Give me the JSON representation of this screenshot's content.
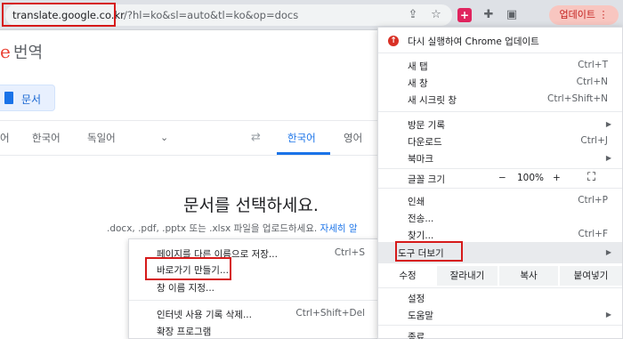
{
  "browser": {
    "url_host": "translate.google.co.kr",
    "url_path": "/?hl=ko&sl=auto&tl=ko&op=docs",
    "update_button": "업데이트 ⋮"
  },
  "page": {
    "logo_letter": "e",
    "logo_text": "번역",
    "docs_chip": "문서",
    "source_langs": [
      "어",
      "한국어",
      "독일어"
    ],
    "target_langs": [
      "한국어",
      "영어"
    ],
    "heading": "문서를 선택하세요.",
    "subtitle": ".docx, .pdf, .pptx 또는 .xlsx 파일을 업로드하세요.",
    "subtitle_link": "자세히 알"
  },
  "context_menu": {
    "items": [
      {
        "label": "페이지를 다른 이름으로 저장...",
        "shortcut": "Ctrl+S"
      },
      {
        "label": "바로가기 만들기...",
        "shortcut": ""
      },
      {
        "label": "창 이름 지정...",
        "shortcut": ""
      },
      {
        "label": "인터넷 사용 기록 삭제...",
        "shortcut": "Ctrl+Shift+Del"
      },
      {
        "label": "확장 프로그램",
        "shortcut": ""
      }
    ]
  },
  "chrome_menu": {
    "update_item": "다시 실행하여 Chrome 업데이트",
    "new_tab": {
      "label": "새 탭",
      "shortcut": "Ctrl+T"
    },
    "new_window": {
      "label": "새 창",
      "shortcut": "Ctrl+N"
    },
    "incognito": {
      "label": "새 시크릿 창",
      "shortcut": "Ctrl+Shift+N"
    },
    "history": "방문 기록",
    "downloads": {
      "label": "다운로드",
      "shortcut": "Ctrl+J"
    },
    "bookmarks": "북마크",
    "font_size": "글꼴 크기",
    "zoom_minus": "−",
    "zoom_value": "100%",
    "zoom_plus": "+",
    "fullscreen": "⛶",
    "print": {
      "label": "인쇄",
      "shortcut": "Ctrl+P"
    },
    "cast": "전송...",
    "find": {
      "label": "찾기...",
      "shortcut": "Ctrl+F"
    },
    "more_tools": "도구 더보기",
    "edit": "수정",
    "cut": "잘라내기",
    "copy": "복사",
    "paste": "붙여넣기",
    "settings": "설정",
    "help": "도움말",
    "exit": "종료"
  }
}
